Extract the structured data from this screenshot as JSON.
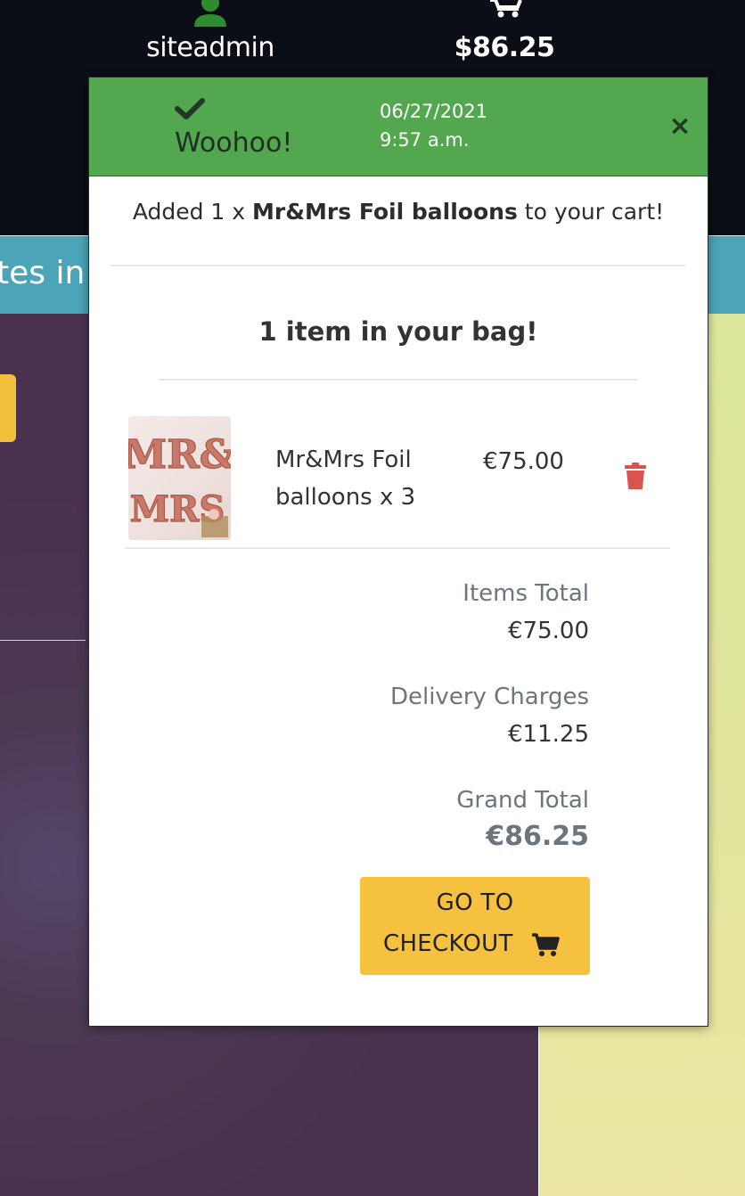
{
  "navbar": {
    "account_label": "siteadmin",
    "bag_total": "$86.25"
  },
  "banner": {
    "text": "tes in"
  },
  "toast": {
    "heading": "Woohoo!",
    "date": "06/27/2021",
    "time": "9:57 a.m.",
    "close_label": "×",
    "added_prefix": "Added 1 x ",
    "added_product": "Mr&Mrs Foil balloons",
    "added_suffix": " to your cart!",
    "bag_count": "1 item in your bag!",
    "item": {
      "name": "Mr&Mrs Foil balloons x 3",
      "price": "€75.00",
      "image_text": "MR & MRS"
    },
    "items_total_label": "Items Total",
    "items_total": "€75.00",
    "delivery_label": "Delivery Charges",
    "delivery": "€11.25",
    "grand_total_label": "Grand Total",
    "grand_total": "€86.25",
    "checkout_line1": "GO TO",
    "checkout_line2": "CHECKOUT"
  },
  "colors": {
    "navbar": "#0b0e17",
    "toast_header": "#53a74f",
    "checkout_button": "#f5c13f",
    "trash": "#d9534f",
    "user_icon": "#2e8b2e"
  },
  "icons": [
    "user-icon",
    "cart-icon",
    "check-icon",
    "close-icon",
    "trash-icon",
    "cart-icon"
  ]
}
